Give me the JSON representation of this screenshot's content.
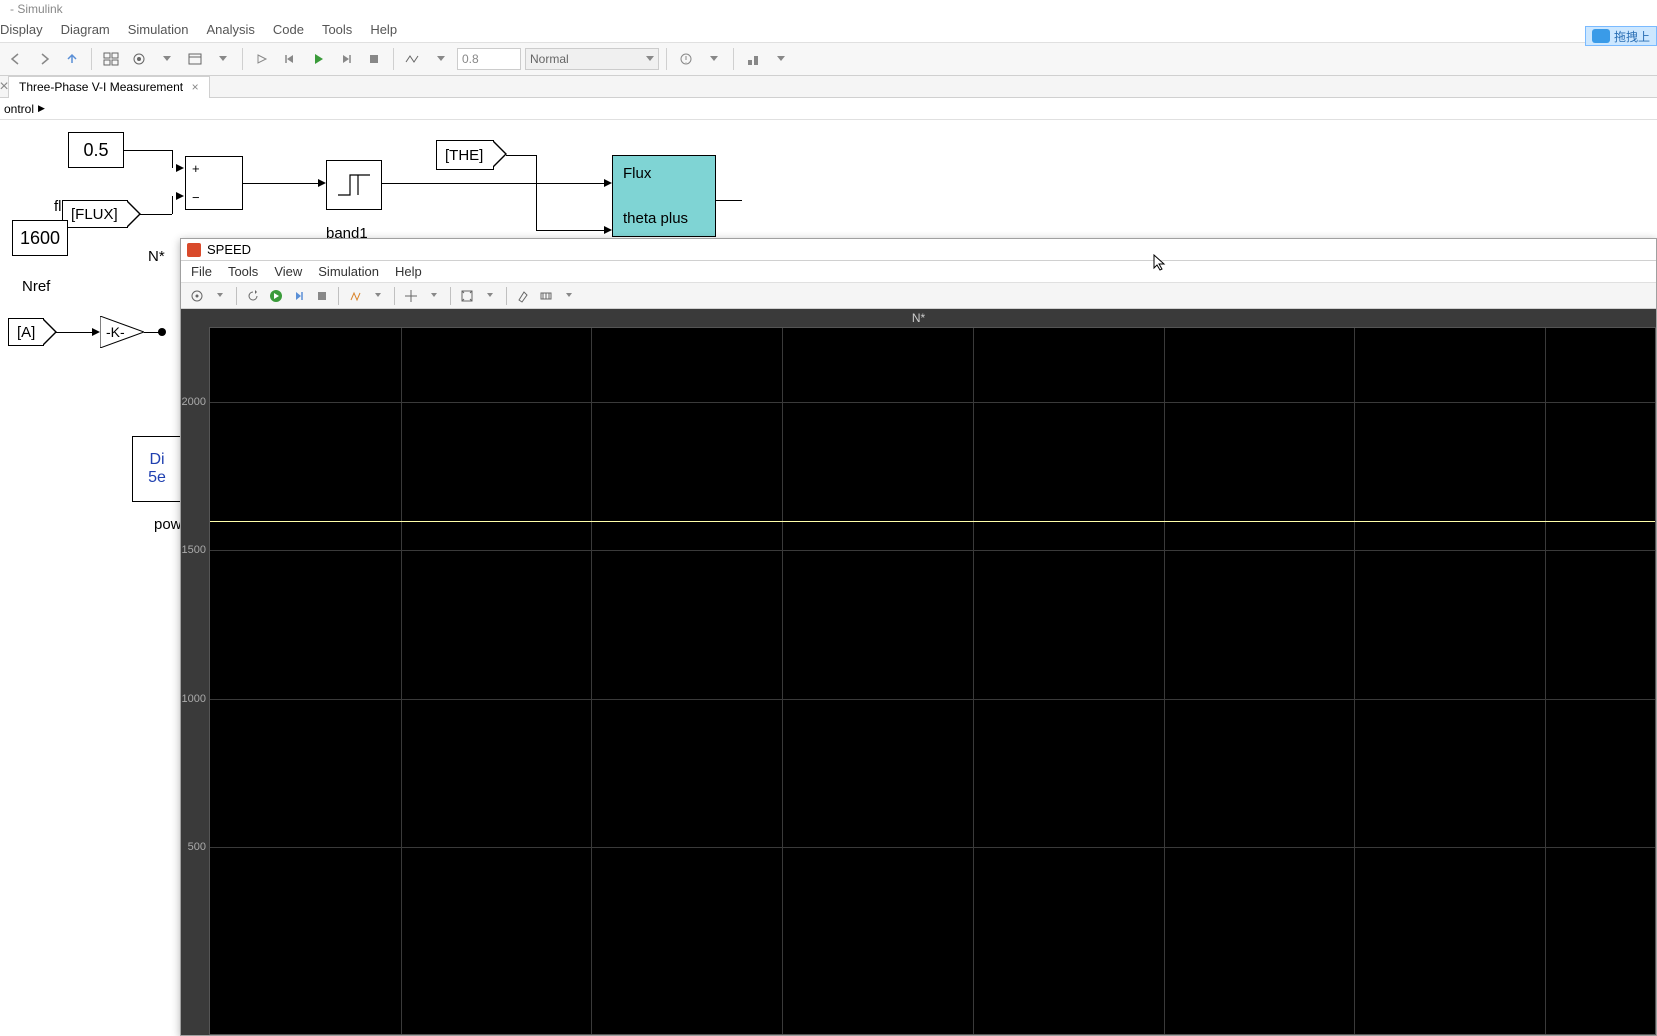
{
  "window": {
    "title": "- Simulink"
  },
  "main_menu": {
    "display": "Display",
    "diagram": "Diagram",
    "simulation": "Simulation",
    "analysis": "Analysis",
    "code": "Code",
    "tools": "Tools",
    "help": "Help"
  },
  "main_toolbar": {
    "time_input": "0.8",
    "mode": "Normal"
  },
  "tabs": {
    "close_x": "×",
    "active": "Three-Phase V-I Measurement"
  },
  "breadcrumb": {
    "root": "ontrol",
    "arrow": "▶"
  },
  "cloud_badge": {
    "text": "拖拽上"
  },
  "blocks": {
    "const05": "0.5",
    "flu_label": "flu",
    "flux_tag": "[FLUX]",
    "n1600": "1600",
    "nstar": "N*",
    "nref": "Nref",
    "a_tag": "[A]",
    "gain_k": "-K-",
    "sum_plus": "+",
    "sum_minus": "−",
    "band_label": "band1",
    "the_tag": "[THE]",
    "flux_port": "Flux",
    "theta_port": "theta    plus",
    "di_line1": "Di",
    "di_line2": "5e",
    "pow_label": "pow"
  },
  "scope": {
    "title": "SPEED",
    "menu": {
      "file": "File",
      "tools": "Tools",
      "view": "View",
      "simulation": "Simulation",
      "help": "Help"
    },
    "plot_title": "N*",
    "y_ticks": [
      "2000",
      "1500",
      "1000",
      "500"
    ]
  },
  "chart_data": {
    "type": "line",
    "title": "N*",
    "ylabel": "",
    "xlabel": "",
    "ylim": [
      300,
      2300
    ],
    "series": [
      {
        "name": "N*",
        "approx_constant_value": 1600
      }
    ]
  }
}
